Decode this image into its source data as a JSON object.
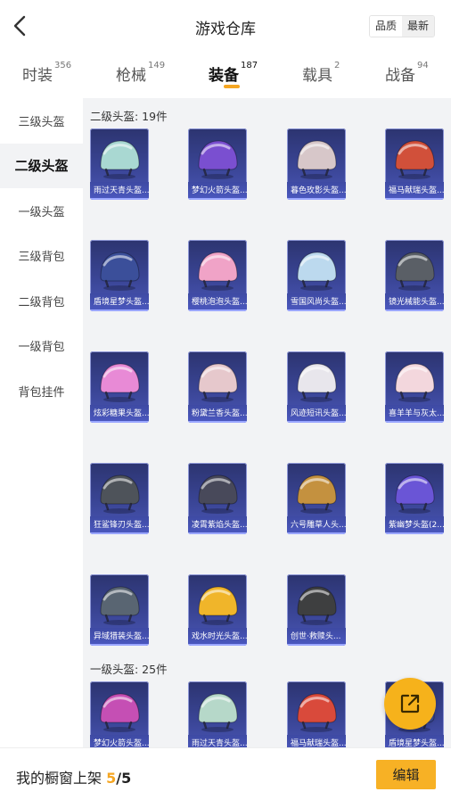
{
  "header": {
    "title": "游戏仓库",
    "sort": [
      "品质",
      "最新"
    ],
    "active_sort": 0
  },
  "tabs": [
    {
      "label": "时装",
      "count": "356"
    },
    {
      "label": "枪械",
      "count": "149"
    },
    {
      "label": "装备",
      "count": "187"
    },
    {
      "label": "载具",
      "count": "2"
    },
    {
      "label": "战备",
      "count": "94"
    }
  ],
  "active_tab": 2,
  "sidebar": {
    "items": [
      "三级头盔",
      "二级头盔",
      "一级头盔",
      "三级背包",
      "二级背包",
      "一级背包",
      "背包挂件"
    ],
    "active": 1
  },
  "sections": [
    {
      "title": "二级头盔: 19件",
      "items": [
        {
          "label": "雨过天青头盔...",
          "color": "#a9d8d2"
        },
        {
          "label": "梦幻火箭头盔...",
          "color": "#7a4fd0"
        },
        {
          "label": "暮色玫影头盔...",
          "color": "#d7c7c9"
        },
        {
          "label": "福马献瑞头盔...",
          "color": "#d1503a"
        },
        {
          "label": "盾境星梦头盔...",
          "color": "#3b4f9a"
        },
        {
          "label": "樱桃泡泡头盔...",
          "color": "#f0a3c7"
        },
        {
          "label": "雪国风尚头盔...",
          "color": "#bcd9ee"
        },
        {
          "label": "镜光械能头盔...",
          "color": "#5a5f66"
        },
        {
          "label": "炫彩糖果头盔...",
          "color": "#e88ad6"
        },
        {
          "label": "粉黛兰香头盔...",
          "color": "#e6c8cc"
        },
        {
          "label": "风迹短讯头盔...",
          "color": "#e8e6ec"
        },
        {
          "label": "喜羊羊与灰太...",
          "color": "#f3d7dd"
        },
        {
          "label": "狂鲨锋刃头盔...",
          "color": "#4e535a"
        },
        {
          "label": "凌霄紫焰头盔...",
          "color": "#48495a"
        },
        {
          "label": "六号雕草人头...",
          "color": "#c4913f"
        },
        {
          "label": "紫幽梦头盔(2...",
          "color": "#6a55d6"
        },
        {
          "label": "异域猎装头盔...",
          "color": "#596572"
        },
        {
          "label": "戏水时光头盔...",
          "color": "#f0b52a"
        },
        {
          "label": "创世·救赎头...",
          "color": "#3e3f40"
        }
      ]
    },
    {
      "title": "一级头盔: 25件",
      "items": [
        {
          "label": "梦幻火箭头盔...",
          "color": "#c54fb4"
        },
        {
          "label": "雨过天青头盔...",
          "color": "#b6d8c9"
        },
        {
          "label": "福马献瑞头盔...",
          "color": "#d94a3b"
        },
        {
          "label": "盾境星梦头盔...",
          "color": "#3e4f9b"
        }
      ]
    }
  ],
  "footer": {
    "caption": "我的橱窗上架",
    "count_current": "5",
    "count_total": "/5",
    "edit_label": "编辑"
  },
  "colors": {
    "accent": "#f5a623",
    "card_bg": "#3a4596"
  }
}
